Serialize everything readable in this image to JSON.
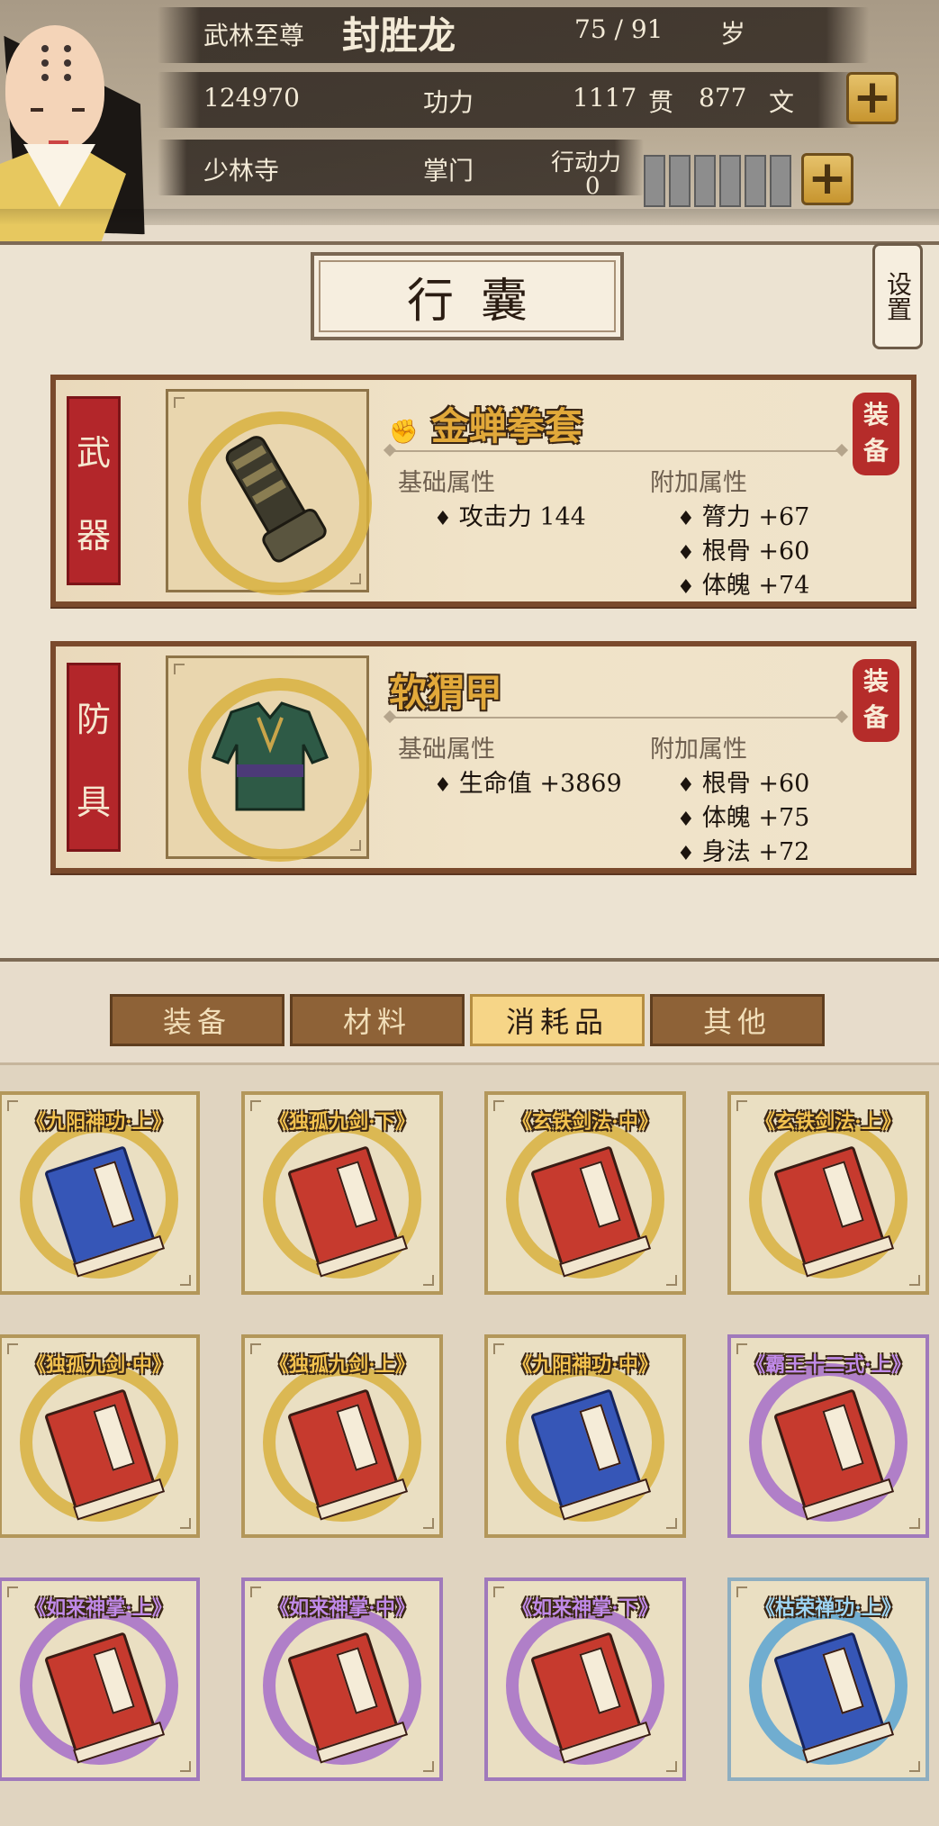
{
  "header": {
    "rank_title": "武林至尊",
    "player_name": "封胜龙",
    "age": "75 / 91",
    "age_unit": "岁",
    "power_value": "124970",
    "power_label": "功力",
    "money_guan": "1117",
    "money_guan_unit": "贯",
    "money_wen": "877",
    "money_wen_unit": "文",
    "sect": "少林寺",
    "sect_role": "掌门",
    "stamina_label": "行动力",
    "stamina_value": "0",
    "stamina_segments_total": 6,
    "plus_icon": "plus-icon"
  },
  "panel": {
    "title": "行囊",
    "settings_label": "设置"
  },
  "equipment": {
    "base_header": "基础属性",
    "extra_header": "附加属性",
    "equip_label": "装备",
    "weapon": {
      "slot_label_1": "武",
      "slot_label_2": "器",
      "name": "金蝉拳套",
      "base_stats": [
        "攻击力 144"
      ],
      "extra_stats": [
        "膂力 +67",
        "根骨 +60",
        "体魄 +74"
      ]
    },
    "armor": {
      "slot_label_1": "防",
      "slot_label_2": "具",
      "name": "软猬甲",
      "base_stats": [
        "生命值 +3869"
      ],
      "extra_stats": [
        "根骨 +60",
        "体魄 +75",
        "身法 +72"
      ]
    }
  },
  "tabs": [
    {
      "label": "装备",
      "active": false
    },
    {
      "label": "材料",
      "active": false
    },
    {
      "label": "消耗品",
      "active": true
    },
    {
      "label": "其他",
      "active": false
    }
  ],
  "inventory": [
    {
      "label": "《九阳神功·上》",
      "rarity": "gold",
      "book": "blue"
    },
    {
      "label": "《独孤九剑·下》",
      "rarity": "gold",
      "book": "red"
    },
    {
      "label": "《玄铁剑法·中》",
      "rarity": "gold",
      "book": "red"
    },
    {
      "label": "《玄铁剑法·上》",
      "rarity": "gold",
      "book": "red"
    },
    {
      "label": "《独孤九剑·中》",
      "rarity": "gold",
      "book": "red"
    },
    {
      "label": "《独孤九剑·上》",
      "rarity": "gold",
      "book": "red"
    },
    {
      "label": "《九阳神功·中》",
      "rarity": "gold",
      "book": "blue"
    },
    {
      "label": "《霸王十二式·上》",
      "rarity": "purple",
      "book": "red"
    },
    {
      "label": "《如来神掌·上》",
      "rarity": "purple",
      "book": "red"
    },
    {
      "label": "《如来神掌·中》",
      "rarity": "purple",
      "book": "red"
    },
    {
      "label": "《如来神掌·下》",
      "rarity": "purple",
      "book": "red"
    },
    {
      "label": "《枯荣禅功·上》",
      "rarity": "blue",
      "book": "blue"
    }
  ],
  "colors": {
    "gold_rarity": "#d8b140",
    "purple_rarity": "#a66ec9",
    "blue_rarity": "#5aa4d2",
    "tab_active": "#f6d587",
    "tab_inactive": "#8e6237"
  }
}
